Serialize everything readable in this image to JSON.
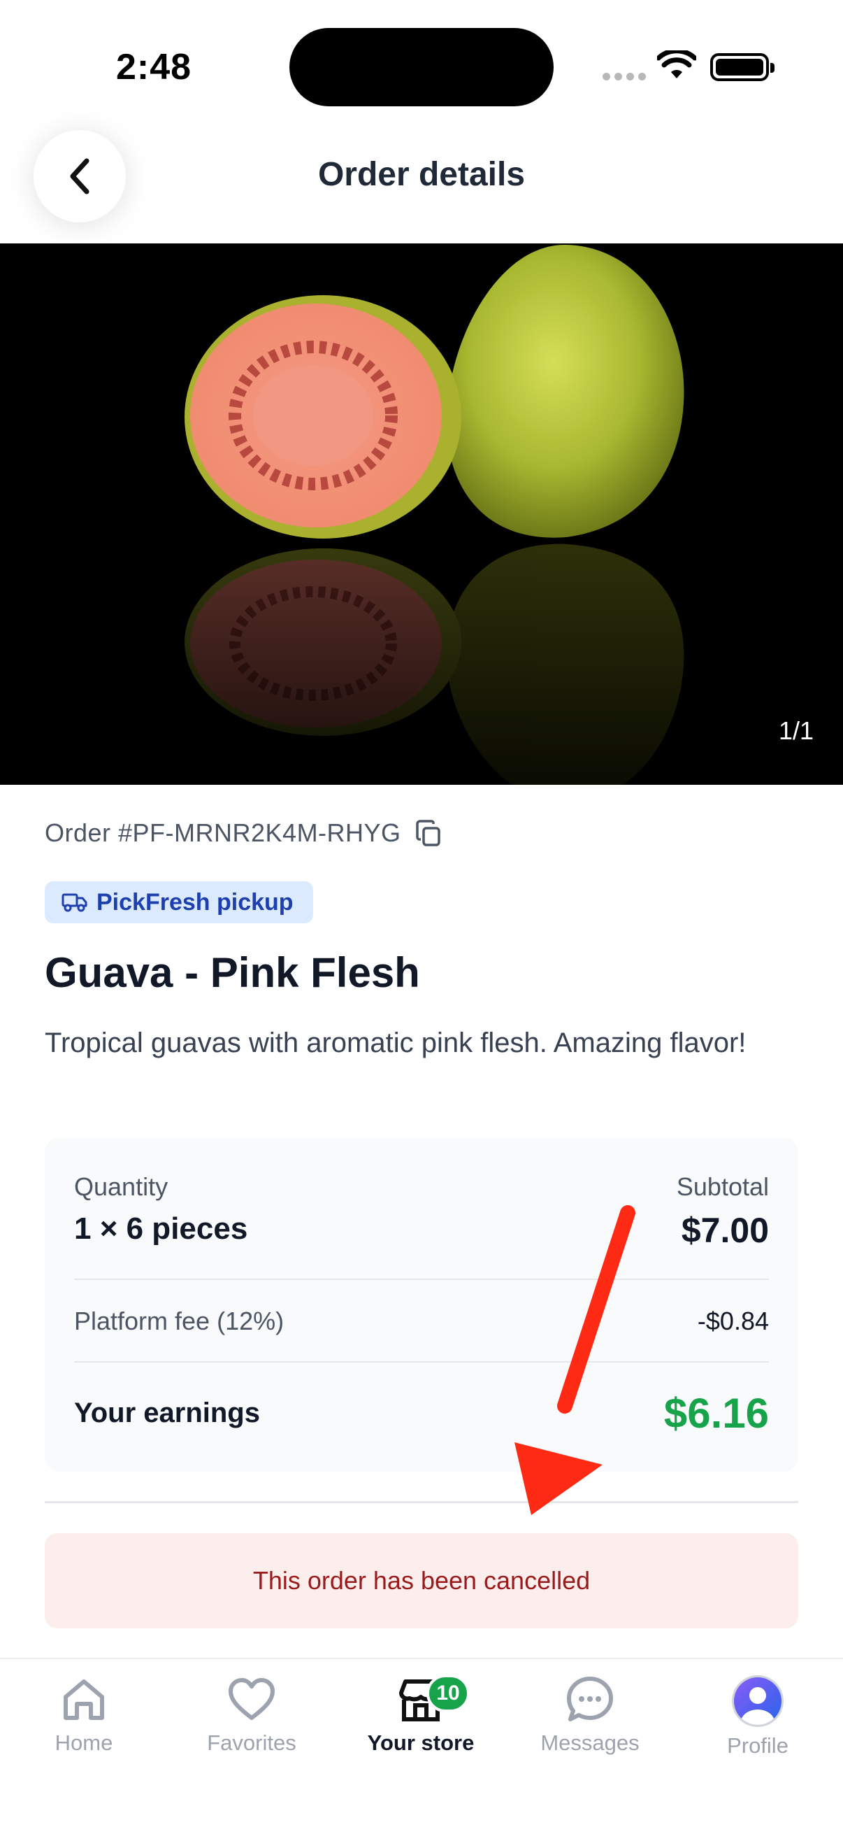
{
  "status_bar": {
    "time": "2:48"
  },
  "header": {
    "title": "Order details"
  },
  "image": {
    "counter": "1/1"
  },
  "order": {
    "id": "Order #PF-MRNR2K4M-RHYG",
    "badge": "PickFresh pickup",
    "product_name": "Guava - Pink Flesh",
    "description": "Tropical guavas with aromatic pink flesh. Amazing flavor!"
  },
  "summary": {
    "quantity_label": "Quantity",
    "quantity_value": "1 × 6 pieces",
    "subtotal_label": "Subtotal",
    "subtotal_value": "$7.00",
    "fee_label": "Platform fee (12%)",
    "fee_value": "-$0.84",
    "earnings_label": "Your earnings",
    "earnings_value": "$6.16",
    "earnings_color": "#16a34a"
  },
  "cancel_notice": "This order has been cancelled",
  "nav": {
    "items": [
      {
        "label": "Home",
        "icon": "home-icon"
      },
      {
        "label": "Favorites",
        "icon": "heart-icon"
      },
      {
        "label": "Your store",
        "icon": "store-icon",
        "badge": "10",
        "active": true
      },
      {
        "label": "Messages",
        "icon": "chat-icon"
      },
      {
        "label": "Profile",
        "icon": "avatar-icon"
      }
    ]
  },
  "colors": {
    "badge_bg": "#dbeafe",
    "badge_text": "#1e40af",
    "cancel_bg": "#fdeeee",
    "cancel_text": "#991b1b",
    "annotation_arrow": "#ff2a14"
  }
}
